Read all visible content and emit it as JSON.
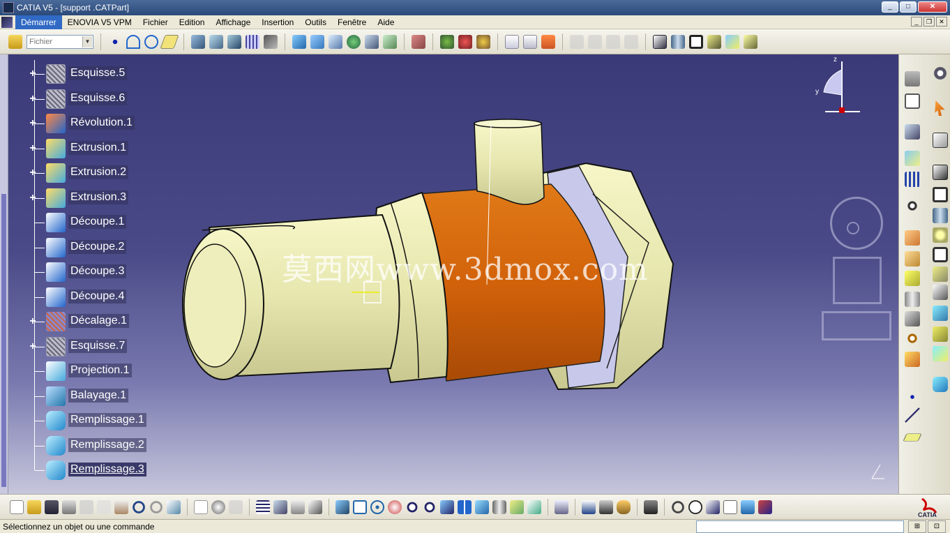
{
  "window": {
    "title": "CATIA V5 - [support .CATPart]"
  },
  "menu": {
    "items": [
      "Démarrer",
      "ENOVIA V5 VPM",
      "Fichier",
      "Edition",
      "Affichage",
      "Insertion",
      "Outils",
      "Fenêtre",
      "Aide"
    ]
  },
  "toolbar": {
    "file_combo_placeholder": "Fichier"
  },
  "tree": {
    "nodes": [
      {
        "label": "Esquisse.5",
        "icon": "sketch-icon"
      },
      {
        "label": "Esquisse.6",
        "icon": "sketch-icon"
      },
      {
        "label": "Révolution.1",
        "icon": "revolution-icon"
      },
      {
        "label": "Extrusion.1",
        "icon": "extrusion-icon"
      },
      {
        "label": "Extrusion.2",
        "icon": "extrusion-icon"
      },
      {
        "label": "Extrusion.3",
        "icon": "extrusion-icon"
      },
      {
        "label": "Découpe.1",
        "icon": "split-icon"
      },
      {
        "label": "Découpe.2",
        "icon": "split-icon"
      },
      {
        "label": "Découpe.3",
        "icon": "split-icon"
      },
      {
        "label": "Découpe.4",
        "icon": "split-icon"
      },
      {
        "label": "Décalage.1",
        "icon": "offset-icon"
      },
      {
        "label": "Esquisse.7",
        "icon": "sketch-icon"
      },
      {
        "label": "Projection.1",
        "icon": "projection-icon"
      },
      {
        "label": "Balayage.1",
        "icon": "sweep-icon"
      },
      {
        "label": "Remplissage.1",
        "icon": "fill-icon"
      },
      {
        "label": "Remplissage.2",
        "icon": "fill-icon"
      },
      {
        "label": "Remplissage.3",
        "icon": "fill-icon"
      }
    ]
  },
  "viewport": {
    "watermark": "莫西网www.3dmox.com",
    "compass_labels": {
      "z": "z",
      "y": "y"
    }
  },
  "status": {
    "message": "Sélectionnez un objet ou une commande"
  },
  "colors": {
    "part_body": "#e6e6b0",
    "part_highlight": "#d2620a",
    "background_top": "#3a3a78",
    "background_bottom": "#c6c6dc"
  },
  "branding": {
    "logo_text": "CATIA"
  }
}
